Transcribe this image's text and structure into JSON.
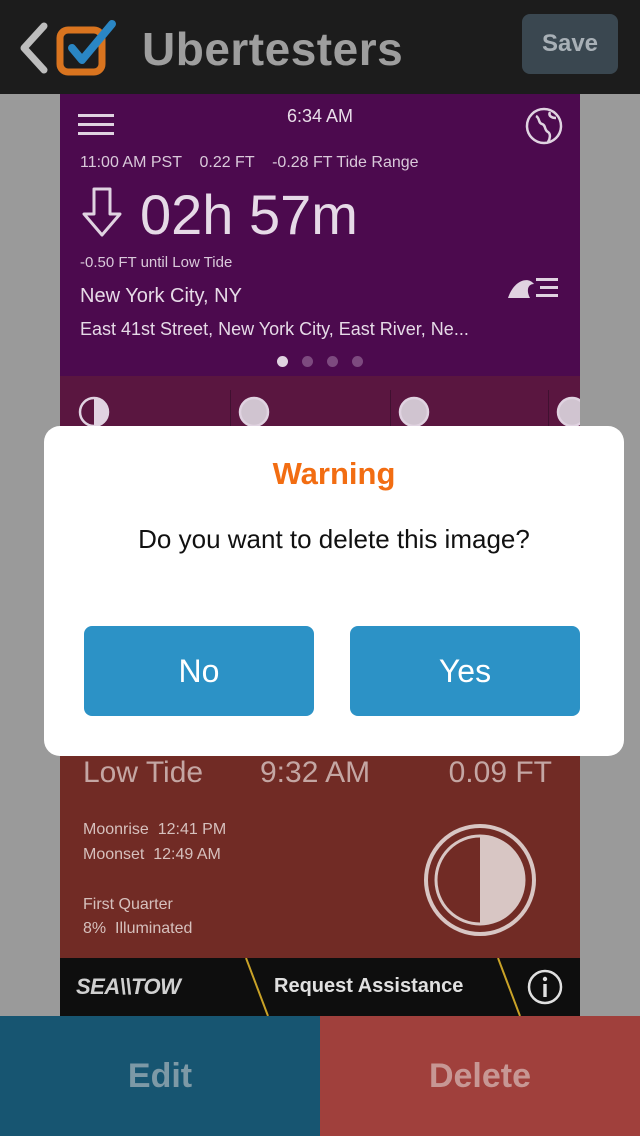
{
  "topbar": {
    "app_title": "Ubertesters",
    "save_label": "Save"
  },
  "screenshot": {
    "time": "6:34 AM",
    "tide_info": "11:00 AM PST    0.22 FT    -0.28 FT Tide Range",
    "countdown": "02h 57m",
    "until_low": "-0.50 FT until Low Tide",
    "city": "New York City, NY",
    "street": "East 41st Street, New York City, East River, Ne...",
    "page_dots": 4,
    "active_dot": 0,
    "low_tide": {
      "label": "Low Tide",
      "time": "9:32 AM",
      "height": "0.09 FT"
    },
    "moonrise": "Moonrise  12:41 PM",
    "moonset": "Moonset  12:49 AM",
    "phase": "First Quarter",
    "illuminated": "8%  Illuminated",
    "ad": {
      "brand": "SEA\\\\TOW",
      "cta": "Request Assistance"
    }
  },
  "dialog": {
    "title": "Warning",
    "message": "Do you want to delete this image?",
    "no_label": "No",
    "yes_label": "Yes"
  },
  "bottom": {
    "edit_label": "Edit",
    "delete_label": "Delete"
  },
  "colors": {
    "accent_orange": "#f26d12",
    "dialog_button": "#2c92c6",
    "edit_bg": "#175571",
    "delete_bg": "#a0403c"
  }
}
